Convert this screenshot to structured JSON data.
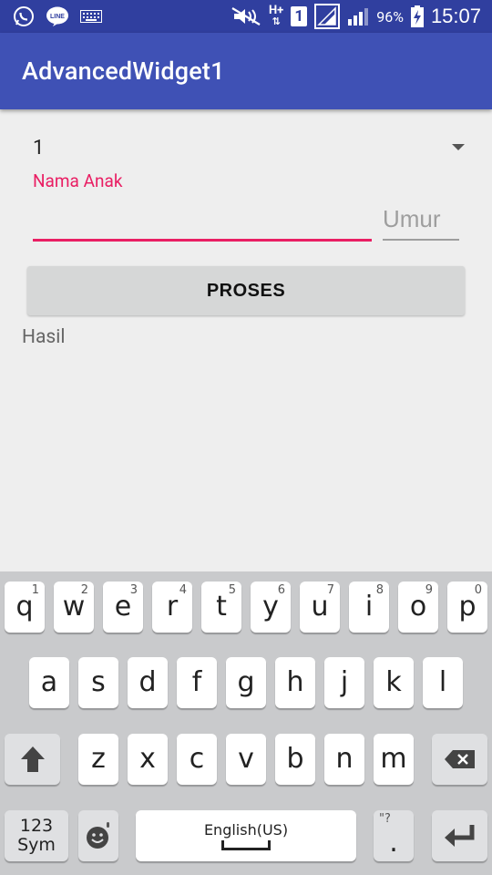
{
  "status_bar": {
    "time": "15:07",
    "battery_percent": "96%",
    "network_type": "H+",
    "sim_slot": "1",
    "icons": [
      "whatsapp-icon",
      "line-icon",
      "keyboard-icon",
      "mute-icon",
      "network-type-icon",
      "sim-icon",
      "signal-icon",
      "signal-icon-2",
      "battery-charging-icon"
    ]
  },
  "app_bar": {
    "title": "AdvancedWidget1"
  },
  "form": {
    "spinner_value": "1",
    "name_label": "Nama Anak",
    "name_value": "",
    "age_placeholder": "Umur",
    "process_button": "PROSES",
    "result_text": "Hasil"
  },
  "keyboard": {
    "row1": [
      {
        "key": "q",
        "hint": "1"
      },
      {
        "key": "w",
        "hint": "2"
      },
      {
        "key": "e",
        "hint": "3"
      },
      {
        "key": "r",
        "hint": "4"
      },
      {
        "key": "t",
        "hint": "5"
      },
      {
        "key": "y",
        "hint": "6"
      },
      {
        "key": "u",
        "hint": "7"
      },
      {
        "key": "i",
        "hint": "8"
      },
      {
        "key": "o",
        "hint": "9"
      },
      {
        "key": "p",
        "hint": "0"
      }
    ],
    "row2": [
      "a",
      "s",
      "d",
      "f",
      "g",
      "h",
      "j",
      "k",
      "l"
    ],
    "row3": [
      "z",
      "x",
      "c",
      "v",
      "b",
      "n",
      "m"
    ],
    "sym_label_1": "123",
    "sym_label_2": "Sym",
    "space_label": "English(US)",
    "period_label": ".",
    "period_hint": "\"?",
    "colors": {
      "background": "#c9cacc",
      "key": "#ffffff",
      "function_key": "#dfe0e2"
    }
  },
  "colors": {
    "status_bar": "#303f9f",
    "app_bar": "#3f51b5",
    "accent": "#e91e63",
    "background": "#eeeeee"
  }
}
